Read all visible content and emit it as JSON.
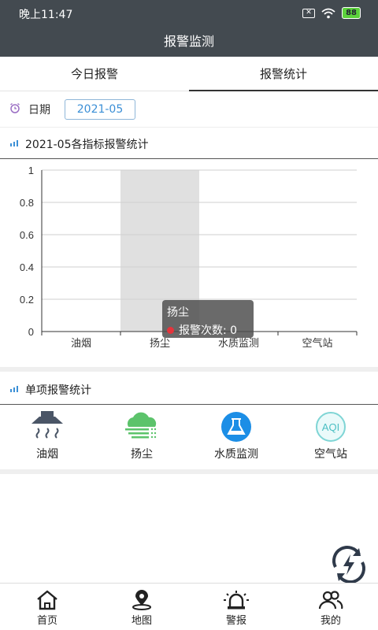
{
  "status": {
    "time": "晚上11:47",
    "battery": "88",
    "sim": "✕"
  },
  "header": {
    "title": "报警监测"
  },
  "tabs": [
    {
      "label": "今日报警"
    },
    {
      "label": "报警统计"
    }
  ],
  "date": {
    "label": "日期",
    "value": "2021-05"
  },
  "chart_section": {
    "title": "2021-05各指标报警统计"
  },
  "chart_data": {
    "type": "bar",
    "categories": [
      "油烟",
      "扬尘",
      "水质监测",
      "空气站"
    ],
    "series": [
      {
        "name": "报警次数",
        "values": [
          0,
          0,
          0,
          0
        ]
      }
    ],
    "ylim": [
      0,
      1
    ],
    "yticks": [
      "0",
      "0.2",
      "0.4",
      "0.6",
      "0.8",
      "1"
    ],
    "highlight_category": "扬尘",
    "grid": true
  },
  "tooltip": {
    "title": "扬尘",
    "series": "报警次数",
    "value": "0",
    "text": "报警次数: 0"
  },
  "single_section": {
    "title": "单项报警统计"
  },
  "single_items": [
    {
      "label": "油烟",
      "icon": "range-hood-icon"
    },
    {
      "label": "扬尘",
      "icon": "dust-cloud-icon"
    },
    {
      "label": "水质监测",
      "icon": "flask-icon"
    },
    {
      "label": "空气站",
      "icon": "aqi-icon",
      "icon_text": "AQI"
    }
  ],
  "nav": [
    {
      "label": "首页",
      "icon": "home-icon"
    },
    {
      "label": "地图",
      "icon": "map-pin-icon"
    },
    {
      "label": "警报",
      "icon": "alarm-icon"
    },
    {
      "label": "我的",
      "icon": "user-group-icon"
    }
  ],
  "colors": {
    "header": "#434a50",
    "accent": "#3b8fd6",
    "highlight_band": "#e0e0e0",
    "tooltip_dot": "#e6343c"
  }
}
